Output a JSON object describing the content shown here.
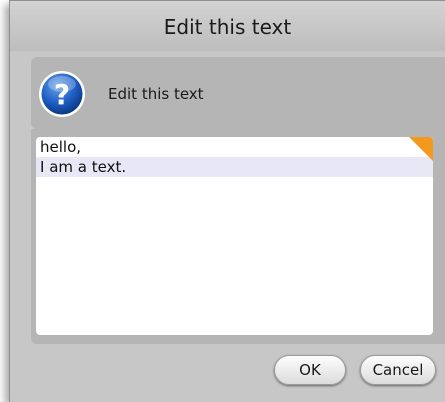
{
  "dialog": {
    "title": "Edit this text",
    "message": "Edit this text",
    "icon": "question-icon",
    "accent_color": "#f39a1e"
  },
  "editor": {
    "lines": [
      "hello,",
      "I am a text."
    ]
  },
  "buttons": {
    "ok_label": "OK",
    "cancel_label": "Cancel"
  }
}
